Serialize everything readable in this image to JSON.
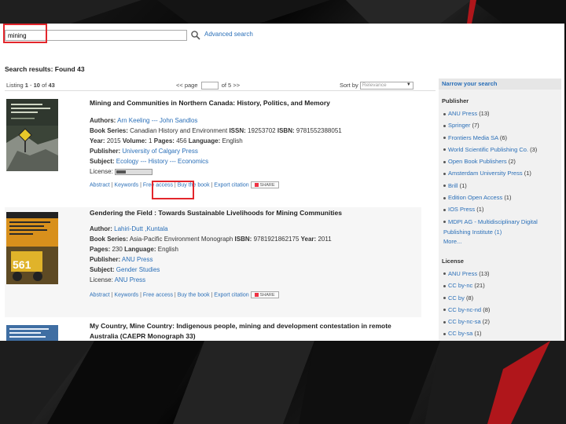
{
  "search": {
    "value": "mining",
    "advanced_label": "Advanced search"
  },
  "results_title": "Search results: Found 43",
  "listing": {
    "prefix": "Listing",
    "from": "1",
    "dash": "-",
    "to": "10",
    "of_label": "of",
    "total": "43",
    "prev": "<< page",
    "page_of": "of 5",
    "next": ">>",
    "sort_label": "Sort by",
    "sort_value": "Relevance"
  },
  "results": [
    {
      "title": "Mining and Communities in Northern Canada: History, Politics, and Memory",
      "authors_label": "Authors:",
      "authors": "Arn Keeling --- John Sandlos",
      "series_label": "Book Series:",
      "series": "Canadian History and Environment",
      "issn_label": "ISSN:",
      "issn": "19253702",
      "isbn_label": "ISBN:",
      "isbn": "9781552388051",
      "year_label": "Year:",
      "year": "2015",
      "volume_label": "Volume:",
      "volume": "1",
      "pages_label": "Pages:",
      "pages": "456",
      "language_label": "Language:",
      "language": "English",
      "publisher_label": "Publisher:",
      "publisher": "University of Calgary Press",
      "subject_label": "Subject:",
      "subject": "Ecology --- History --- Economics",
      "license_label": "License:",
      "actions": [
        "Abstract",
        "Keywords",
        "Free access",
        "Buy the book",
        "Export citation"
      ],
      "share": "SHARE"
    },
    {
      "title": "Gendering the Field : Towards Sustainable Livelihoods for Mining Communities",
      "author_label": "Author:",
      "author": "Lahiri-Dutt ,Kuntala",
      "series_label": "Book Series:",
      "series": "Asia-Pacific Environment Monograph",
      "isbn_label": "ISBN:",
      "isbn": "9781921862175",
      "year_label": "Year:",
      "year": "2011",
      "pages_label": "Pages:",
      "pages": "230",
      "language_label": "Language:",
      "language": "English",
      "publisher_label": "Publisher:",
      "publisher": "ANU Press",
      "subject_label": "Subject:",
      "subject": "Gender Studies",
      "license_label": "License:",
      "license": "ANU Press",
      "actions": [
        "Abstract",
        "Keywords",
        "Free access",
        "Buy the book",
        "Export citation"
      ],
      "share": "SHARE"
    },
    {
      "title": "My Country, Mine Country: Indigenous people, mining and development contestation in remote Australia (CAEPR Monograph 33)"
    }
  ],
  "sidebar": {
    "header": "Narrow your search",
    "publisher_title": "Publisher",
    "publishers": [
      {
        "name": "ANU Press",
        "count": "(13)"
      },
      {
        "name": "Springer",
        "count": "(7)"
      },
      {
        "name": "Frontiers Media SA",
        "count": "(6)"
      },
      {
        "name": "World Scientific Publishing Co.",
        "count": "(3)"
      },
      {
        "name": "Open Book Publishers",
        "count": "(2)"
      },
      {
        "name": "Amsterdam University Press",
        "count": "(1)"
      },
      {
        "name": "Brill",
        "count": "(1)"
      },
      {
        "name": "Edition Open Access",
        "count": "(1)"
      },
      {
        "name": "IOS Press",
        "count": "(1)"
      },
      {
        "name": "MDPI AG - Multidisciplinary Digital",
        "count": ""
      }
    ],
    "publisher_wrap": "Publishing Institute (1)",
    "more": "More...",
    "license_title": "License",
    "licenses": [
      {
        "name": "ANU Press",
        "count": "(13)"
      },
      {
        "name": "CC by-nc",
        "count": "(21)"
      },
      {
        "name": "CC by",
        "count": "(8)"
      },
      {
        "name": "CC by-nc-nd",
        "count": "(8)"
      },
      {
        "name": "CC by-nc-sa",
        "count": "(2)"
      },
      {
        "name": "CC by-sa",
        "count": "(1)"
      }
    ]
  },
  "colors": {
    "highlight": "#e3262c",
    "link": "#2a6fb8"
  }
}
